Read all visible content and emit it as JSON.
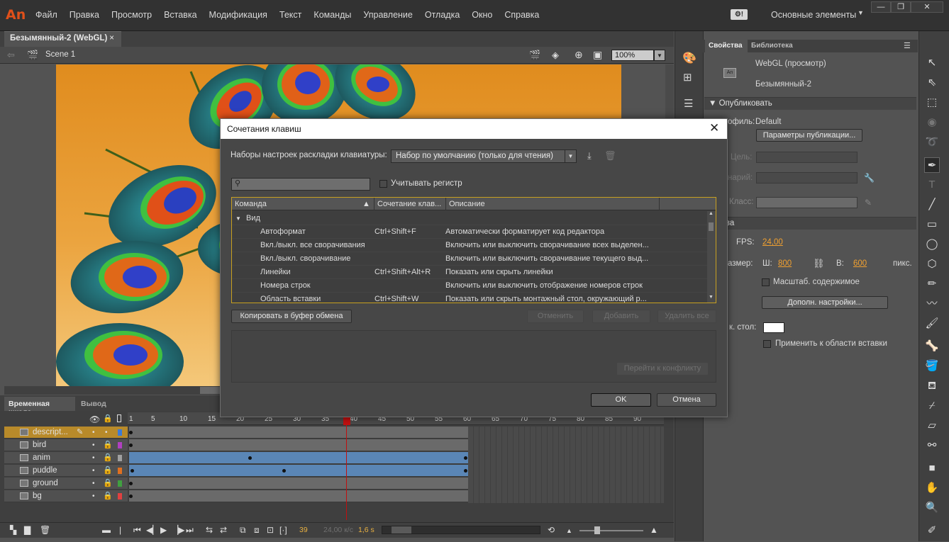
{
  "app": {
    "logo": "An"
  },
  "menu": [
    "Файл",
    "Правка",
    "Просмотр",
    "Вставка",
    "Модификация",
    "Текст",
    "Команды",
    "Управление",
    "Отладка",
    "Окно",
    "Справка"
  ],
  "workspace": "Основные элементы",
  "window_controls": {
    "minimize": "—",
    "restore": "❐",
    "close": "✕"
  },
  "document": {
    "tab": "Безымянный-2 (WebGL)",
    "close": "×",
    "scene": "Scene 1",
    "zoom": "100%"
  },
  "timeline": {
    "tab_timeline": "Временная шкала",
    "tab_output": "Вывод",
    "ruler": [
      "1",
      "5",
      "10",
      "15",
      "20",
      "25",
      "30",
      "35",
      "40",
      "45",
      "50",
      "55",
      "60",
      "65",
      "70",
      "75",
      "80",
      "85",
      "90"
    ],
    "layers": [
      "descript...",
      "bird",
      "anim",
      "puddle",
      "ground",
      "bg"
    ],
    "layer_colors": [
      "#3d7bd6",
      "#b040c0",
      "#a0a0a0",
      "#e07020",
      "#40a040",
      "#e04040"
    ],
    "current_frame": "39",
    "fps": "24,00 к/с",
    "time": "1,6 s"
  },
  "properties": {
    "tab_properties": "Свойства",
    "tab_library": "Библиотека",
    "doc_type": "WebGL (просмотр)",
    "doc_name": "Безымянный-2",
    "publish_section": "Опубликовать",
    "profile_label": "офиль:",
    "profile_value": "Default",
    "publish_settings_button": "Параметры публикации...",
    "target_label": "Цель:",
    "script_label": "нарий:",
    "class_label": "Класс:",
    "props_section": "ойства",
    "fps_label": "FPS:",
    "fps_value": "24,00",
    "size_label": "азмер:",
    "width_label": "Ш:",
    "width_value": "800",
    "height_label": "В:",
    "height_value": "600",
    "units": "пикс.",
    "scale_content": "Масштаб. содержимое",
    "advanced_button": "Дополн. настройки...",
    "stage_label": "к. стол:",
    "apply_paste": "Применить к области вставки"
  },
  "dialog": {
    "title": "Сочетания клавиш",
    "close": "✕",
    "preset_label": "Наборы настроек раскладки клавиатуры:",
    "preset_value": "Набор по умолчанию (только для чтения)",
    "search_placeholder": "",
    "case_label": "Учитывать регистр",
    "columns": [
      "Команда",
      "Сочетание клав...",
      "Описание"
    ],
    "group": "Вид",
    "rows": [
      {
        "command": "Автоформат",
        "shortcut": "Ctrl+Shift+F",
        "description": "Автоматически форматирует код редактора"
      },
      {
        "command": "Вкл./выкл. все сворачивания",
        "shortcut": "",
        "description": "Включить или выключить сворачивание всех выделен..."
      },
      {
        "command": "Вкл./выкл. сворачивание",
        "shortcut": "",
        "description": "Включить или выключить сворачивание текущего выд..."
      },
      {
        "command": "Линейки",
        "shortcut": "Ctrl+Shift+Alt+R",
        "description": "Показать или скрыть линейки"
      },
      {
        "command": "Номера строк",
        "shortcut": "",
        "description": "Включить или выключить отображение номеров строк"
      },
      {
        "command": "Область вставки",
        "shortcut": "Ctrl+Shift+W",
        "description": "Показать или скрыть монтажный стол, окружающий р..."
      }
    ],
    "copy_button": "Копировать в буфер обмена",
    "undo_button": "Отменить",
    "add_button": "Добавить",
    "delete_all_button": "Удалить все",
    "goto_conflict_button": "Перейти к конфликту",
    "ok_button": "OK",
    "cancel_button": "Отмена"
  }
}
